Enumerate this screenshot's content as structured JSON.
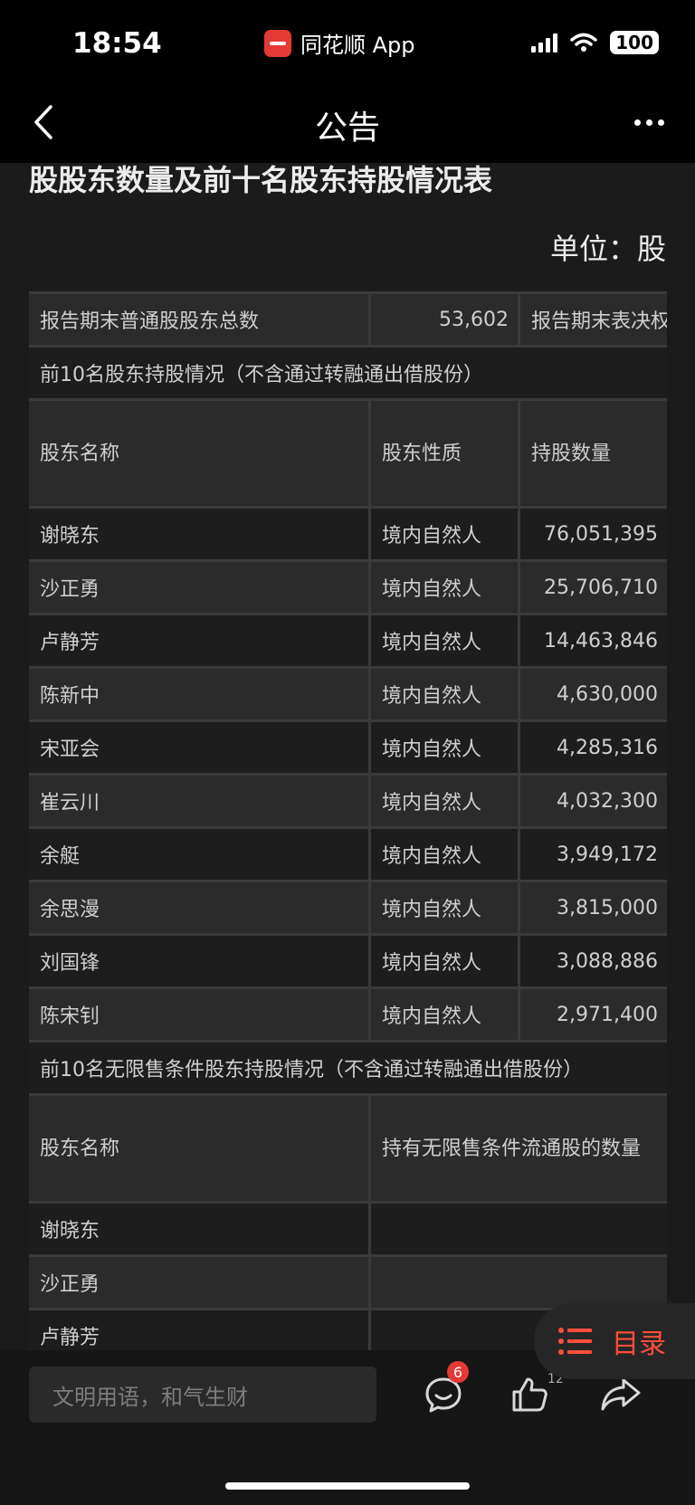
{
  "status_bar": {
    "time": "18:54",
    "app_name": "同花顺 App",
    "battery": "100"
  },
  "nav": {
    "title": "公告"
  },
  "document": {
    "heading": "股股东数量及前十名股东持股情况表",
    "unit": "单位：股",
    "summary": {
      "label": "报告期末普通股股东总数",
      "value": "53,602",
      "next_label": "报告期末表决权"
    },
    "top10_title": "前10名股东持股情况（不含通过转融通出借股份）",
    "top10_headers": [
      "股东名称",
      "股东性质",
      "持股数量"
    ],
    "top10_rows": [
      [
        "谢晓东",
        "境内自然人",
        "76,051,395"
      ],
      [
        "沙正勇",
        "境内自然人",
        "25,706,710"
      ],
      [
        "卢静芳",
        "境内自然人",
        "14,463,846"
      ],
      [
        "陈新中",
        "境内自然人",
        "4,630,000"
      ],
      [
        "宋亚会",
        "境内自然人",
        "4,285,316"
      ],
      [
        "崔云川",
        "境内自然人",
        "4,032,300"
      ],
      [
        "余艇",
        "境内自然人",
        "3,949,172"
      ],
      [
        "余思漫",
        "境内自然人",
        "3,815,000"
      ],
      [
        "刘国锋",
        "境内自然人",
        "3,088,886"
      ],
      [
        "陈宋钊",
        "境内自然人",
        "2,971,400"
      ]
    ],
    "unrestricted_title": "前10名无限售条件股东持股情况（不含通过转融通出借股份）",
    "unrestricted_headers": [
      "股东名称",
      "持有无限售条件流通股的数量"
    ],
    "unrestricted_rows": [
      "谢晓东",
      "沙正勇",
      "卢静芳"
    ]
  },
  "toc": {
    "label": "目录"
  },
  "bottom_bar": {
    "comment_placeholder": "文明用语，和气生财",
    "comment_badge": "6",
    "like_count": "12"
  }
}
